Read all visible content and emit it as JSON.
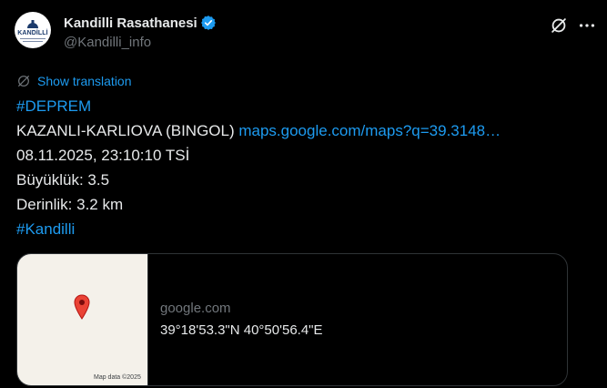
{
  "author": {
    "display_name": "Kandilli Rasathanesi",
    "handle": "@Kandilli_info",
    "verified_icon": "verified-badge-icon",
    "avatar_logo": "KANDİLLİ",
    "badge_color": "#1d9bf0"
  },
  "actions": {
    "grok_icon": "grok-icon",
    "more_icon": "more-icon"
  },
  "translate": {
    "icon": "globe-icon",
    "label": "Show translation"
  },
  "tweet": {
    "hashtag1": "#DEPREM",
    "location": "KAZANLI-KARLIOVA (BINGOL) ",
    "link": "maps.google.com/maps?q=39.3148…",
    "datetime": "08.11.2025, 23:10:10 TSİ",
    "magnitude": "Büyüklük: 3.5",
    "depth": "Derinlik: 3.2 km",
    "hashtag2": "#Kandilli"
  },
  "card": {
    "map_credit": "Map data ©2025",
    "domain": "google.com",
    "title": "39°18'53.3\"N 40°50'56.4\"E",
    "pin_icon": "map-pin-icon",
    "pin_color": "#ea4335"
  }
}
